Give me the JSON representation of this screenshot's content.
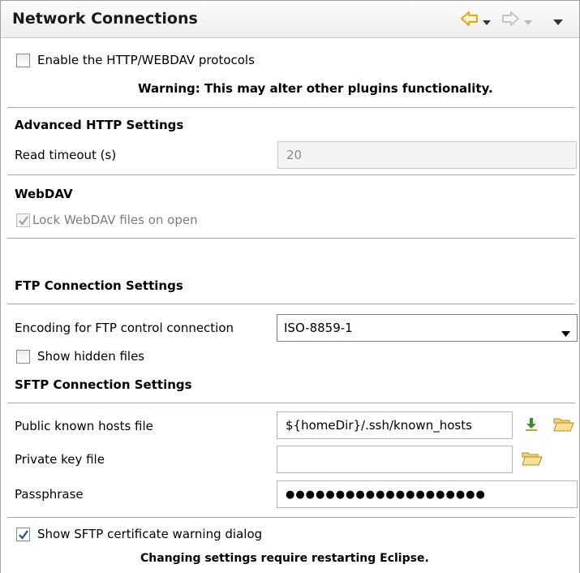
{
  "header": {
    "title": "Network Connections",
    "back_icon": "back-arrow-icon",
    "forward_icon": "forward-arrow-icon",
    "menu_icon": "view-menu-icon"
  },
  "http": {
    "enable_label": "Enable the HTTP/WEBDAV protocols",
    "enable_checked": false,
    "warning": "Warning: This may alter other plugins functionality."
  },
  "advanced_http": {
    "heading": "Advanced HTTP Settings",
    "read_timeout_label": "Read timeout (s)",
    "read_timeout_value": "20"
  },
  "webdav": {
    "heading": "WebDAV",
    "lock_label": "Lock WebDAV files on open",
    "lock_checked": true
  },
  "ftp": {
    "heading": "FTP Connection Settings",
    "encoding_label": "Encoding for FTP control connection",
    "encoding_value": "ISO-8859-1",
    "hidden_files_label": "Show hidden files",
    "hidden_files_checked": false
  },
  "sftp": {
    "heading": "SFTP Connection Settings",
    "known_hosts_label": "Public known hosts file",
    "known_hosts_value": "${homeDir}/.ssh/known_hosts",
    "private_key_label": "Private key file",
    "private_key_value": "",
    "passphrase_label": "Passphrase",
    "passphrase_value": "●●●●●●●●●●●●●●●●●●●●",
    "cert_warning_label": "Show SFTP certificate warning dialog",
    "cert_warning_checked": true,
    "restart_note": "Changing settings require restarting Eclipse."
  },
  "colors": {
    "accent_arrow": "#e8a317",
    "checkmark": "#1b4f9c",
    "download_icon": "#3a8a2e",
    "folder_icon": "#e2b54a"
  }
}
